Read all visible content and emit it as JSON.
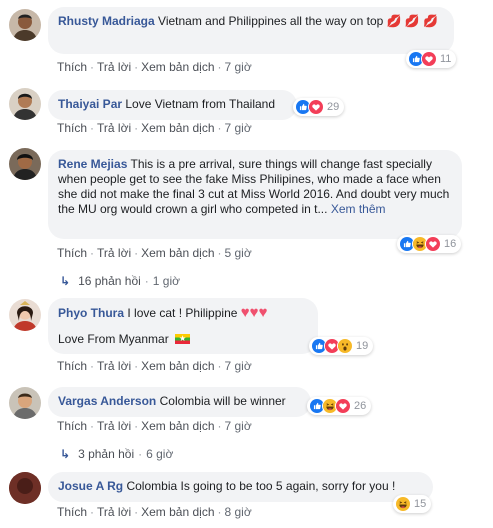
{
  "comments": [
    {
      "name": "Rhusty Madriaga",
      "text": "Vietnam and Philippines all the way on top 💋 💋 💋",
      "like": "Thích",
      "reply": "Trả lời",
      "translate": "Xem bản dịch",
      "time": "7 giờ",
      "reaction_count": "11",
      "reactions": [
        "like-icon",
        "love-icon"
      ]
    },
    {
      "name": "Thaiyai Par",
      "text": "Love Vietnam from Thailand",
      "like": "Thích",
      "reply": "Trả lời",
      "translate": "Xem bản dịch",
      "time": "7 giờ",
      "reaction_count": "29",
      "reactions": [
        "like-icon",
        "love-icon"
      ]
    },
    {
      "name": "Rene Mejias",
      "text": "This is a pre arrival, sure things will change fast specially when people get to see the fake Miss Philipines, who made a face when she did not make the final 3 cut at Miss World 2016. And doubt very much the MU org would crown a girl who competed in t...",
      "more": "Xem thêm",
      "like": "Thích",
      "reply": "Trả lời",
      "translate": "Xem bản dịch",
      "time": "5 giờ",
      "reaction_count": "16",
      "reactions": [
        "like-icon",
        "haha-icon",
        "love-icon"
      ],
      "replies_label": "16 phản hồi",
      "replies_time": "1 giờ"
    },
    {
      "name": "Phyo Thura",
      "text": "I love cat ! Philippine",
      "text2": "Love From Myanmar",
      "like": "Thích",
      "reply": "Trả lời",
      "translate": "Xem bản dịch",
      "time": "7 giờ",
      "reaction_count": "19",
      "reactions": [
        "like-icon",
        "love-icon",
        "wow-icon"
      ]
    },
    {
      "name": "Vargas Anderson",
      "text": "Colombia will be winner",
      "like": "Thích",
      "reply": "Trả lời",
      "translate": "Xem bản dịch",
      "time": "7 giờ",
      "reaction_count": "26",
      "reactions": [
        "like-icon",
        "haha-icon",
        "love-icon"
      ],
      "replies_label": "3 phản hồi",
      "replies_time": "6 giờ"
    },
    {
      "name": "Josue A Rg",
      "text": "Colombia Is going to be too 5 again, sorry for you !",
      "like": "Thích",
      "reply": "Trả lời",
      "translate": "Xem bản dịch",
      "time": "8 giờ",
      "reaction_count": "15",
      "reactions": [
        "haha-icon"
      ]
    }
  ],
  "colors": {
    "name_link": "#385898",
    "bubble_bg": "#f2f3f5",
    "meta_text": "#616770",
    "like_blue": "#1877f2",
    "love_red": "#f33e58",
    "haha_yellow": "#f7b928"
  }
}
